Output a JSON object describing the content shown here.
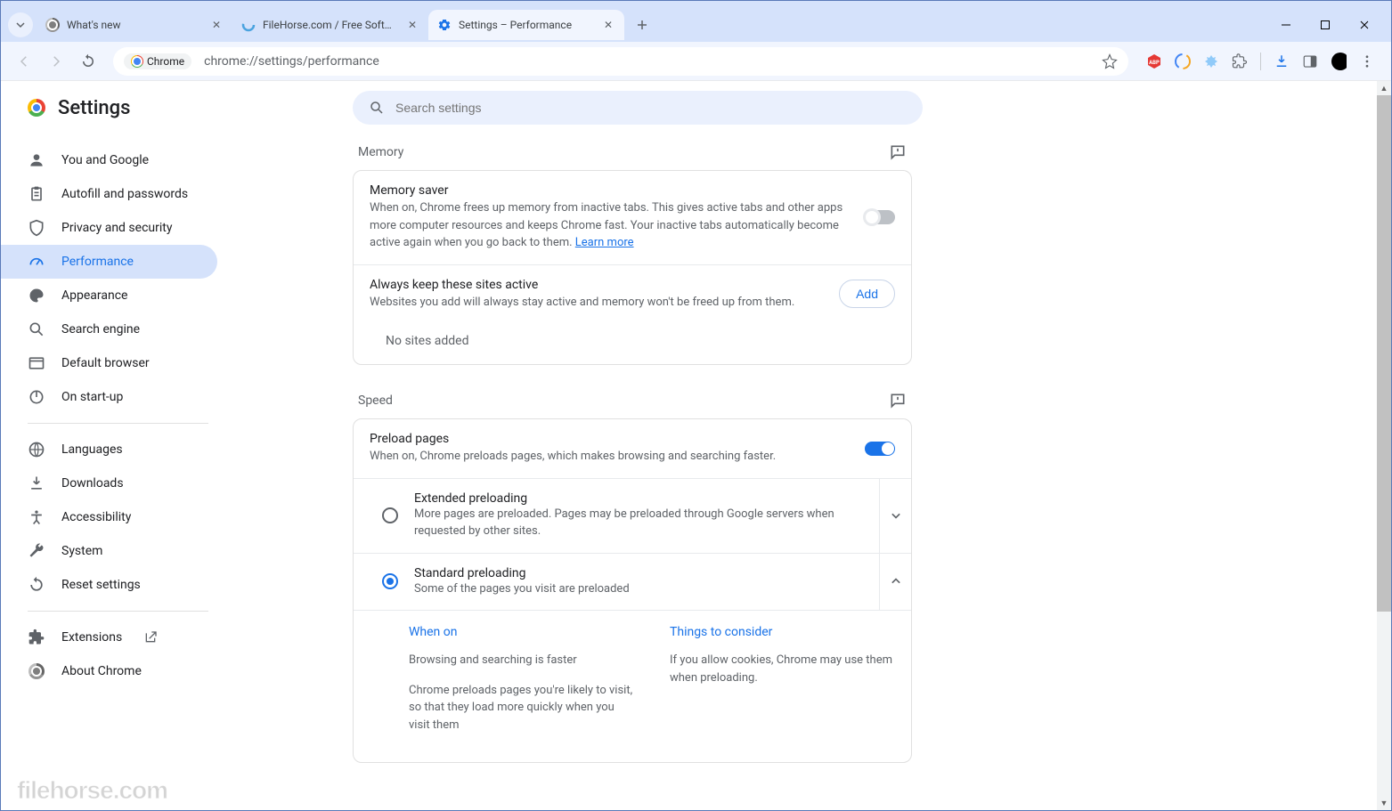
{
  "tabs": [
    {
      "title": "What's new"
    },
    {
      "title": "FileHorse.com / Free Software"
    },
    {
      "title": "Settings – Performance"
    }
  ],
  "newtab": "+",
  "omnibox": {
    "chip": "Chrome",
    "url": "chrome://settings/performance"
  },
  "app_title": "Settings",
  "search_placeholder": "Search settings",
  "sidebar": {
    "items": [
      {
        "label": "You and Google"
      },
      {
        "label": "Autofill and passwords"
      },
      {
        "label": "Privacy and security"
      },
      {
        "label": "Performance"
      },
      {
        "label": "Appearance"
      },
      {
        "label": "Search engine"
      },
      {
        "label": "Default browser"
      },
      {
        "label": "On start-up"
      }
    ],
    "items2": [
      {
        "label": "Languages"
      },
      {
        "label": "Downloads"
      },
      {
        "label": "Accessibility"
      },
      {
        "label": "System"
      },
      {
        "label": "Reset settings"
      }
    ],
    "items3": [
      {
        "label": "Extensions"
      },
      {
        "label": "About Chrome"
      }
    ]
  },
  "memory": {
    "heading": "Memory",
    "saver_title": "Memory saver",
    "saver_desc": "When on, Chrome frees up memory from inactive tabs. This gives active tabs and other apps more computer resources and keeps Chrome fast. Your inactive tabs automatically become active again when you go back to them. ",
    "learn": "Learn more",
    "always_title": "Always keep these sites active",
    "always_desc": "Websites you add will always stay active and memory won't be freed up from them.",
    "add": "Add",
    "empty": "No sites added"
  },
  "speed": {
    "heading": "Speed",
    "preload_title": "Preload pages",
    "preload_desc": "When on, Chrome preloads pages, which makes browsing and searching faster.",
    "ext_title": "Extended preloading",
    "ext_desc": "More pages are preloaded. Pages may be preloaded through Google servers when requested by other sites.",
    "std_title": "Standard preloading",
    "std_desc": "Some of the pages you visit are preloaded",
    "when_on_h": "When on",
    "when_on_1": "Browsing and searching is faster",
    "when_on_2": "Chrome preloads pages you're likely to visit, so that they load more quickly when you visit them",
    "consider_h": "Things to consider",
    "consider_1": "If you allow cookies, Chrome may use them when preloading."
  },
  "watermark": "filehorse.com"
}
